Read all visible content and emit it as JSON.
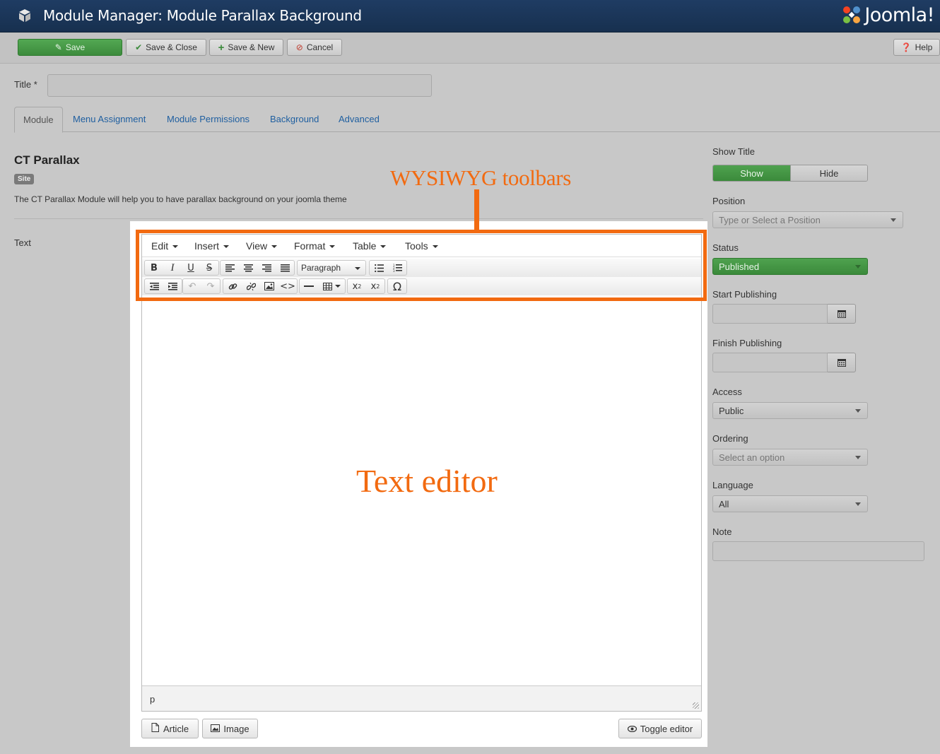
{
  "header": {
    "title": "Module Manager: Module Parallax Background",
    "logo_text": "Joomla!"
  },
  "toolbar": {
    "save": "Save",
    "save_close": "Save & Close",
    "save_new": "Save & New",
    "cancel": "Cancel",
    "help": "Help"
  },
  "form": {
    "title_label": "Title *",
    "title_value": ""
  },
  "tabs": [
    "Module",
    "Menu Assignment",
    "Module Permissions",
    "Background",
    "Advanced"
  ],
  "module": {
    "name": "CT Parallax",
    "badge": "Site",
    "description": "The CT Parallax Module will help you to have parallax background on your joomla theme",
    "text_label": "Text"
  },
  "editor": {
    "menus": [
      "Edit",
      "Insert",
      "View",
      "Format",
      "Table",
      "Tools"
    ],
    "format_select": "Paragraph",
    "path": "p",
    "buttons": {
      "article": "Article",
      "image": "Image",
      "toggle": "Toggle editor"
    }
  },
  "annotations": {
    "toolbars": "WYSIWYG toolbars",
    "editor": "Text editor"
  },
  "sidebar": {
    "show_title_label": "Show Title",
    "show_label": "Show",
    "hide_label": "Hide",
    "position_label": "Position",
    "position_placeholder": "Type or Select a Position",
    "status_label": "Status",
    "status_value": "Published",
    "start_label": "Start Publishing",
    "finish_label": "Finish Publishing",
    "access_label": "Access",
    "access_value": "Public",
    "ordering_label": "Ordering",
    "ordering_placeholder": "Select an option",
    "language_label": "Language",
    "language_value": "All",
    "note_label": "Note"
  },
  "colors": {
    "accent_orange": "#f26a10",
    "header_navy": "#1b365a",
    "success_green": "#46994a"
  }
}
